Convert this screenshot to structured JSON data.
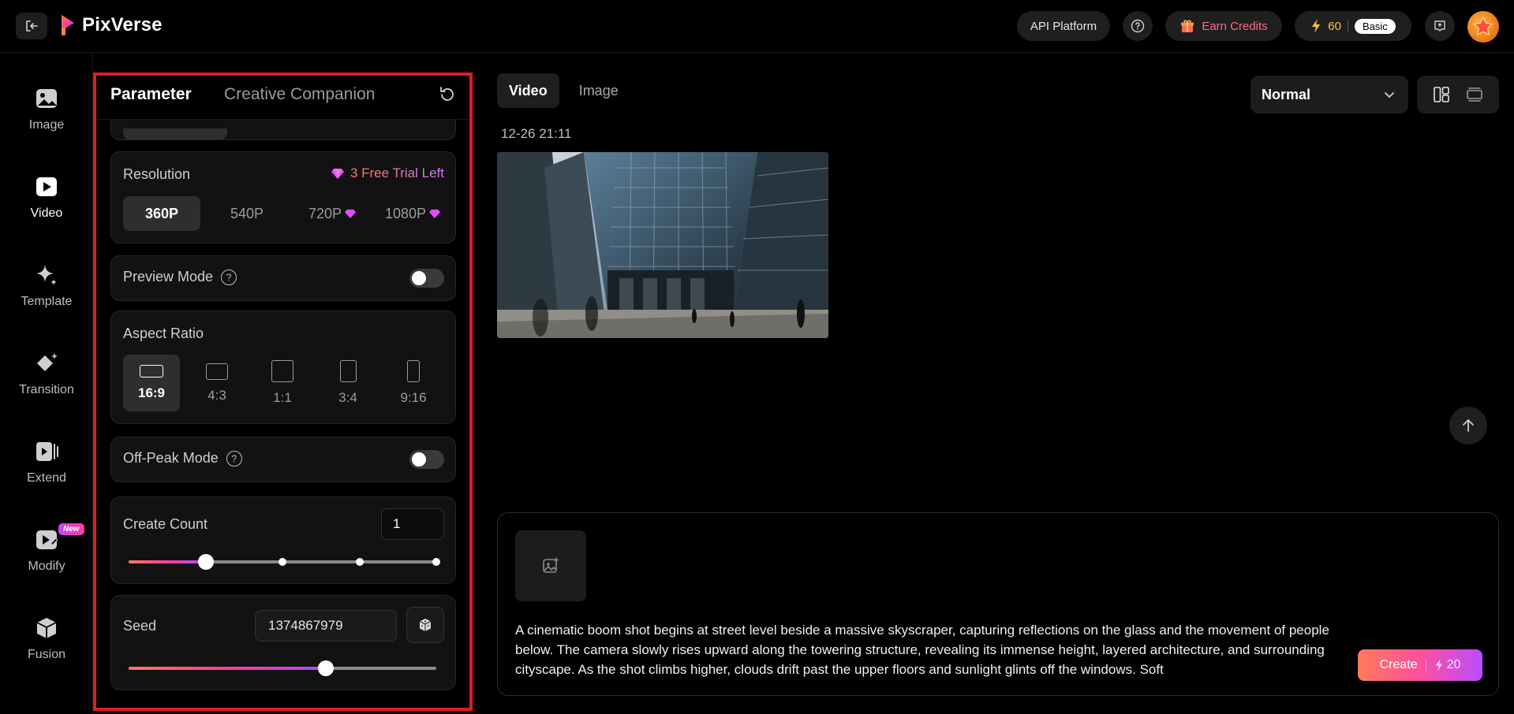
{
  "header": {
    "app_name": "PixVerse",
    "api_label": "API Platform",
    "earn_label": "Earn Credits",
    "credits": "60",
    "plan": "Basic"
  },
  "nav": {
    "items": [
      {
        "label": "Image"
      },
      {
        "label": "Video"
      },
      {
        "label": "Template"
      },
      {
        "label": "Transition"
      },
      {
        "label": "Extend"
      },
      {
        "label": "Modify",
        "badge": "New"
      },
      {
        "label": "Fusion"
      }
    ],
    "active": "Video"
  },
  "panel": {
    "tab_parameter": "Parameter",
    "tab_companion": "Creative Companion",
    "resolution": {
      "label": "Resolution",
      "trial": "3 Free Trial Left",
      "options": [
        "360P",
        "540P",
        "720P",
        "1080P"
      ],
      "selected": "360P"
    },
    "preview_mode": {
      "label": "Preview Mode",
      "enabled": false
    },
    "aspect_ratio": {
      "label": "Aspect Ratio",
      "options": [
        "16:9",
        "4:3",
        "1:1",
        "3:4",
        "9:16"
      ],
      "selected": "16:9"
    },
    "off_peak": {
      "label": "Off-Peak Mode",
      "enabled": false
    },
    "create_count": {
      "label": "Create Count",
      "value": "1",
      "steps": 4
    },
    "seed": {
      "label": "Seed",
      "value": "1374867979",
      "slider_fraction": 0.64
    }
  },
  "main": {
    "tab_video": "Video",
    "tab_image": "Image",
    "quality": "Normal",
    "timestamp": "12-26 21:11",
    "prompt": "A cinematic boom shot begins at street level beside a massive skyscraper, capturing reflections on the glass and the movement of people below. The camera slowly rises upward along the towering structure, revealing its immense height, layered architecture, and surrounding cityscape. As the shot climbs higher, clouds drift past the upper floors and sunlight glints off the windows. Soft",
    "create_label": "Create",
    "create_cost": "20"
  },
  "colors": {
    "highlight_border": "#e01b24",
    "accent_gradient_start": "#ff7a59",
    "accent_gradient_end": "#b84dff",
    "credits_color": "#ffc93c"
  }
}
